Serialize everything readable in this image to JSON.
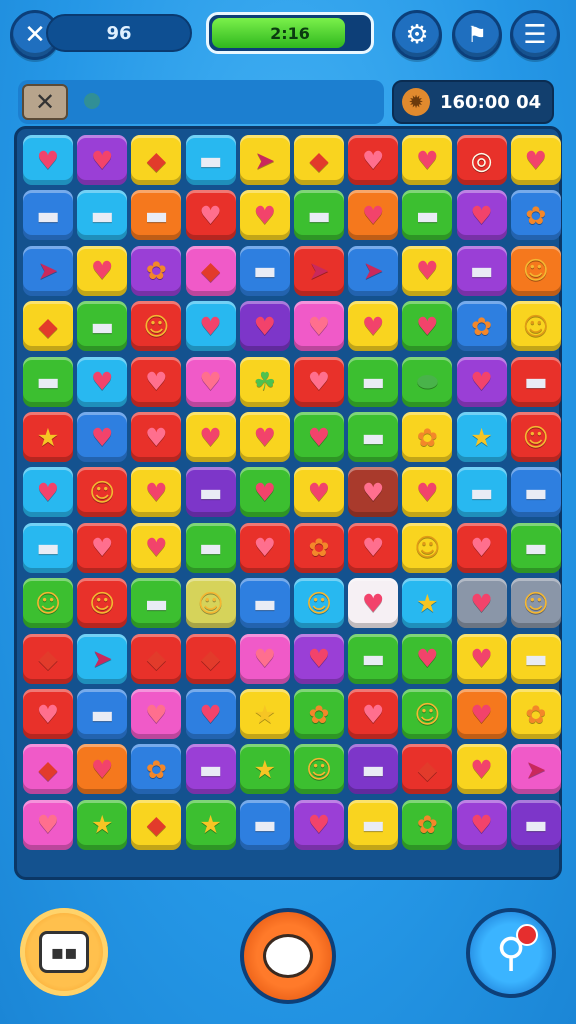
{
  "topbar": {
    "close_icon": "close-icon",
    "score": "96",
    "progress_text": "2:16",
    "progress_fraction": 0.85,
    "settings_icon": "gear-icon",
    "bookmark_icon": "flag-icon",
    "menu_icon": "hamburger-icon"
  },
  "subbar": {
    "close_icon": "close-icon",
    "timer_icon": "gear-icon",
    "timer_text": "160:00 04"
  },
  "colors": {
    "R": "#e8312a",
    "O": "#f5781d",
    "Y": "#f9d41f",
    "G": "#3cbf30",
    "B": "#2e7fe0",
    "C": "#28b8f0",
    "P": "#9a3fd6",
    "K": "#f05ac8",
    "L": "#f6f0f4",
    "S": "#8a96a8",
    "D": "#a93a2c",
    "V": "#7d36c9",
    "M": "#d6d35a"
  },
  "glyph_colors": {
    "heart": "#f2436b",
    "candy": "#e9ecf5",
    "kite": "#e23b2b",
    "star": "#f6c524",
    "blob": "#f4b732",
    "flower": "#f3872a",
    "ring": "#fffbe8",
    "clover": "#4dc24f",
    "bean": "#49b34a",
    "rocket": "#c9295c"
  },
  "glyphs": {
    "heart": "♥",
    "candy": "▬",
    "kite": "◆",
    "star": "★",
    "blob": "☺",
    "flower": "✿",
    "ring": "◎",
    "clover": "☘",
    "bean": "⬬",
    "rocket": "➤"
  },
  "board": {
    "rows": 13,
    "cols": 10,
    "tiles": [
      [
        "C:heart",
        "P:heart",
        "Y:kite",
        "C:candy",
        "Y:rocket",
        "Y:kite",
        "R:heart",
        "Y:heart",
        "R:ring",
        "Y:heart"
      ],
      [
        "B:candy",
        "C:candy",
        "O:candy",
        "R:heart",
        "Y:heart",
        "G:candy",
        "O:heart",
        "G:candy",
        "P:heart",
        "B:flower"
      ],
      [
        "B:rocket",
        "Y:heart",
        "P:flower",
        "K:kite",
        "B:candy",
        "R:rocket",
        "B:rocket",
        "Y:heart",
        "P:candy",
        "O:blob"
      ],
      [
        "Y:kite",
        "G:candy",
        "R:blob",
        "C:heart",
        "V:heart",
        "K:heart",
        "Y:heart",
        "G:heart",
        "B:flower",
        "Y:blob"
      ],
      [
        "G:candy",
        "C:heart",
        "R:heart",
        "K:heart",
        "Y:clover",
        "R:heart",
        "G:candy",
        "G:bean",
        "P:heart",
        "R:candy"
      ],
      [
        "R:star",
        "B:heart",
        "R:heart",
        "Y:heart",
        "Y:heart",
        "G:heart",
        "G:candy",
        "Y:flower",
        "C:star",
        "R:blob"
      ],
      [
        "C:heart",
        "R:blob",
        "Y:heart",
        "V:candy",
        "G:heart",
        "Y:heart",
        "D:heart",
        "Y:heart",
        "C:candy",
        "B:candy"
      ],
      [
        "C:candy",
        "R:heart",
        "Y:heart",
        "G:candy",
        "R:heart",
        "R:flower",
        "R:heart",
        "Y:blob",
        "R:heart",
        "G:candy"
      ],
      [
        "G:blob",
        "R:blob",
        "G:candy",
        "M:blob",
        "B:candy",
        "C:blob",
        "L:heart",
        "C:star",
        "S:heart",
        "S:blob"
      ],
      [
        "R:kite",
        "C:rocket",
        "R:kite",
        "R:kite",
        "K:heart",
        "P:heart",
        "G:candy",
        "G:heart",
        "Y:heart",
        "Y:candy"
      ],
      [
        "R:heart",
        "B:candy",
        "K:heart",
        "B:heart",
        "Y:star",
        "G:flower",
        "R:heart",
        "G:blob",
        "O:heart",
        "Y:flower"
      ],
      [
        "K:kite",
        "O:heart",
        "B:flower",
        "P:candy",
        "G:star",
        "G:blob",
        "V:candy",
        "R:kite",
        "Y:heart",
        "K:rocket"
      ],
      [
        "K:heart",
        "G:star",
        "Y:kite",
        "G:star",
        "B:candy",
        "P:heart",
        "Y:candy",
        "G:flower",
        "P:heart",
        "V:candy"
      ]
    ]
  },
  "bottom": {
    "booster_icon": "robot-icon",
    "shuffle_icon": "speech-bubble-icon",
    "hint_icon": "magnifier-icon"
  }
}
